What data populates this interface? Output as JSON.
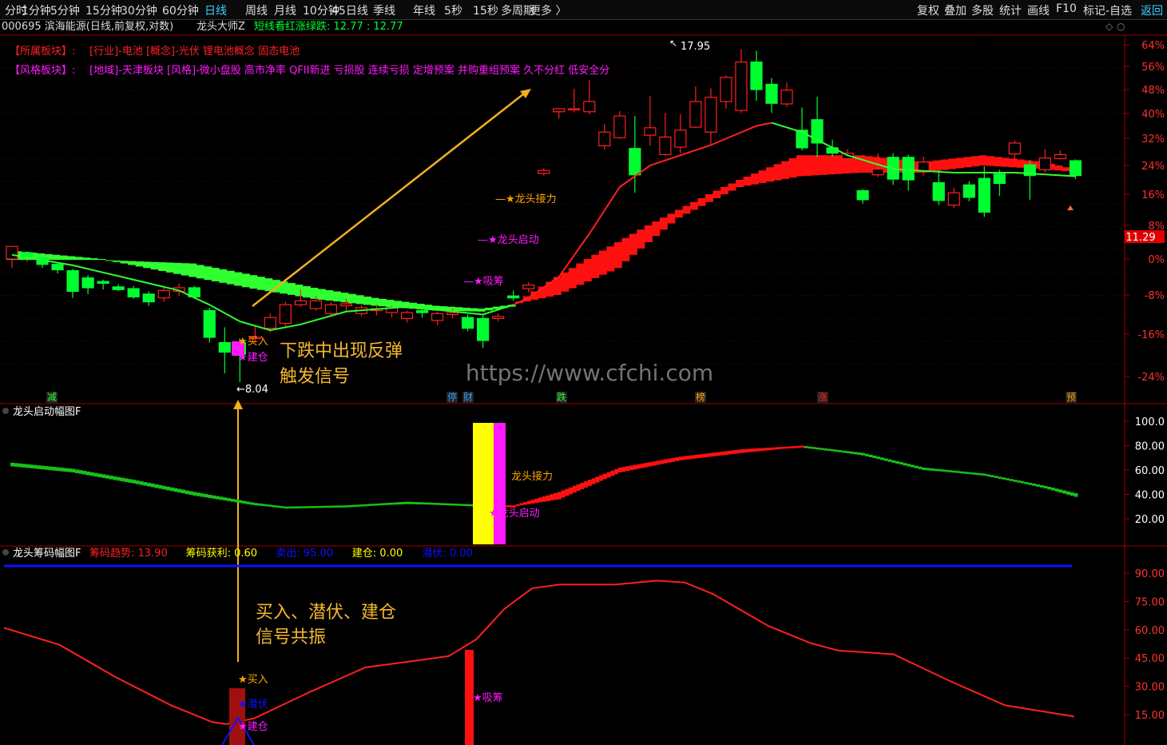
{
  "toolbar": {
    "left": [
      "分时",
      "1分钟",
      "5分钟",
      "15分钟",
      "30分钟",
      "60分钟",
      "日线",
      "周线",
      "月线",
      "10分钟",
      "45日线",
      "季线",
      "年线",
      "5秒",
      "15秒",
      "多周期",
      "更多 〉"
    ],
    "active": "日线",
    "right": [
      "复权",
      "叠加",
      "多股",
      "统计",
      "画线",
      "F10",
      "标记-自选",
      "返回"
    ]
  },
  "header": {
    "stock": "000695 滨海能源(日线,前复权,对数)",
    "indicator": "龙头大师Z",
    "indicator_note": "短线看红涨绿跌: 12.77 : 12.77"
  },
  "sector": {
    "row1": [
      "【所属板块】:",
      "[行业]-电池 [概念]-光伏 锂电池概念 固态电池"
    ],
    "row2": [
      "【风格板块】:",
      "[地域]-天津板块 [风格]-微小盘股 高市净率 QFII新进 亏损股 连续亏损 定增预案 并购重组预案 久不分红 低安全分"
    ]
  },
  "colors": {
    "up": "#ff2020",
    "down": "#00ff30",
    "blue": "#1010ff",
    "yellow": "#ffff00",
    "magenta": "#ff1aff",
    "orange": "#ffa500",
    "annot": "#e6a817",
    "price_tag": "#ff0000"
  },
  "chart_data": [
    {
      "type": "candlestick",
      "title": "龙头大师Z",
      "yaxis_ticks": [
        "64%",
        "56%",
        "48%",
        "40%",
        "32%",
        "24%",
        "16%",
        "8%",
        "0%",
        "-8%",
        "-16%",
        "-24%"
      ],
      "ylim": [
        -28,
        68
      ],
      "candles": [
        [
          2,
          0,
          3,
          -2,
          3
        ],
        [
          3,
          1.5,
          0.3,
          -0.5,
          1.8
        ],
        [
          4,
          0.3,
          -1.2,
          -2,
          0.6
        ],
        [
          5,
          -1.2,
          -2.4,
          -3.2,
          -0.8
        ],
        [
          6,
          -2.6,
          -7.2,
          -8.6,
          -2.2
        ],
        [
          7,
          -4.2,
          -6.4,
          -7.8,
          -3.6
        ],
        [
          8,
          -5,
          -5.4,
          -6.8,
          -4.6
        ],
        [
          9,
          -6.2,
          -6.8,
          -7.2,
          -5.6
        ],
        [
          10,
          -6.6,
          -8.4,
          -8.8,
          -6
        ],
        [
          11,
          -7.8,
          -9.4,
          -10.2,
          -7.2
        ],
        [
          12,
          -8.6,
          -7,
          -9.4,
          -6.4
        ],
        [
          13,
          -7.2,
          -6.4,
          -8.2,
          -5.4
        ],
        [
          14,
          -6.4,
          -8.4,
          -8.8,
          -6
        ],
        [
          15,
          -11.2,
          -16.6,
          -17.6,
          -10.6
        ],
        [
          16,
          -17.6,
          -19.4,
          -23.4,
          -14.6
        ],
        [
          17,
          -17.6,
          -19.8,
          -25,
          -16.8
        ],
        [
          18,
          -16.8,
          -16.6,
          -17.6,
          -14.4
        ],
        [
          19,
          -14.8,
          -12.6,
          -15.6,
          -11.8
        ],
        [
          20,
          -13.8,
          -10,
          -14.4,
          -9.4
        ],
        [
          21,
          -10,
          -9.2,
          -10.4,
          -6.8
        ],
        [
          22,
          -10.8,
          -9.2,
          -11.2,
          -8.2
        ],
        [
          23,
          -11.8,
          -10,
          -12.2,
          -9.4
        ],
        [
          24,
          -10.2,
          -9.8,
          -11.4,
          -8.8
        ],
        [
          25,
          -11.8,
          -10.6,
          -12.4,
          -10
        ],
        [
          26,
          -11.2,
          -10.8,
          -12.2,
          -10
        ],
        [
          27,
          -11.6,
          -10.6,
          -12.6,
          -10.2
        ],
        [
          28,
          -12.8,
          -11.6,
          -13.6,
          -11.2
        ],
        [
          29,
          -11.2,
          -11.6,
          -12.6,
          -10.4
        ],
        [
          30,
          -13.2,
          -11.8,
          -14.2,
          -11.4
        ],
        [
          31,
          -12,
          -11.6,
          -12.8,
          -10.8
        ],
        [
          32,
          -12.6,
          -14.8,
          -15.4,
          -12
        ],
        [
          33,
          -12.8,
          -17.2,
          -18.6,
          -12.2
        ],
        [
          34,
          -12.8,
          -12.4,
          -13.4,
          -11.8
        ],
        [
          35,
          -8.2,
          -8.6,
          -9.2,
          -7
        ],
        [
          36,
          -6.6,
          -5.8,
          -7.4,
          -5.2
        ],
        [
          37,
          21.8,
          22.6,
          23.2,
          21.2
        ],
        [
          38,
          40.6,
          41.6,
          41.8,
          38.4
        ],
        [
          39,
          41.4,
          41.6,
          48.2,
          40.4
        ],
        [
          40,
          40.6,
          44,
          51.2,
          39.8
        ],
        [
          41,
          29.8,
          34,
          36.6,
          28.6
        ],
        [
          42,
          32.2,
          39.2,
          40.8,
          31.8
        ],
        [
          43,
          29,
          21.4,
          39.2,
          16.4
        ],
        [
          44,
          33,
          35.4,
          45.8,
          29.8
        ],
        [
          45,
          27.2,
          32.4,
          40.2,
          26.8
        ],
        [
          46,
          29.4,
          34.6,
          39.8,
          27.6
        ],
        [
          47,
          35.6,
          44,
          49,
          35.4
        ],
        [
          48,
          34,
          45.4,
          48.4,
          30
        ],
        [
          49,
          44,
          52.2,
          52.8,
          41.6
        ],
        [
          50,
          41,
          57.6,
          62.4,
          40.2
        ],
        [
          51,
          57.6,
          48,
          61.8,
          44.2
        ],
        [
          52,
          49.8,
          43.4,
          52,
          40.2
        ],
        [
          53,
          43.2,
          47.8,
          50.4,
          42.2
        ],
        [
          54,
          34.6,
          29.2,
          42,
          28.4
        ],
        [
          55,
          38,
          30.6,
          45.6,
          26.4
        ],
        [
          56,
          29.2,
          27.6,
          31.6,
          26.6
        ],
        [
          57,
          26,
          27.6,
          28.8,
          25
        ],
        [
          58,
          17,
          14.6,
          17.4,
          13.6
        ],
        [
          59,
          21.4,
          23,
          27.6,
          20.8
        ],
        [
          60,
          26.4,
          20.2,
          27.6,
          18.6
        ],
        [
          61,
          26.4,
          20,
          27.2,
          17
        ],
        [
          62,
          22.2,
          25,
          26.6,
          21.2
        ],
        [
          63,
          19.2,
          14.4,
          22.6,
          13.2
        ],
        [
          64,
          13.2,
          16.4,
          17.8,
          12.4
        ],
        [
          65,
          18.6,
          15.2,
          19.6,
          14.2
        ],
        [
          66,
          20.4,
          11.4,
          23.8,
          10.2
        ],
        [
          67,
          21.6,
          19,
          22.8,
          15.6
        ],
        [
          68,
          27.4,
          30.6,
          31.4,
          24.2
        ],
        [
          69,
          24.2,
          21.2,
          25.4,
          14.6
        ],
        [
          70,
          22.8,
          26.2,
          28.8,
          22
        ],
        [
          71,
          26,
          27.2,
          28.4,
          25.8
        ],
        [
          72,
          25.4,
          21.2,
          25.8,
          20.2
        ]
      ],
      "ma_line_points": "short-term trend line",
      "band_note": "trend ribbon (green = downtrend, red = uptrend)",
      "labels": {
        "price_high": "17.95",
        "price_low": "8.04",
        "current_price": "11.29",
        "buy": "★买入",
        "build": "★建仓",
        "absorb": "★吸筹",
        "start": "★龙头启动",
        "relay": "★龙头接力"
      },
      "bottom_tags": [
        "减",
        "停",
        "财",
        "跌",
        "榜",
        "涨",
        "预"
      ],
      "annotation": [
        "下跌中出现反弹",
        "触发信号"
      ],
      "watermark": "https://www.cfchi.com"
    },
    {
      "type": "line",
      "title": "龙头启动幅图F",
      "yaxis_ticks": [
        "100.0",
        "80.00",
        "60.00",
        "40.00",
        "20.00"
      ],
      "ylim": [
        0,
        110
      ],
      "labels": {
        "relay": "龙头接力",
        "start": "★龙头启动"
      }
    },
    {
      "type": "line",
      "title": "龙头筹码幅图F",
      "legend": [
        {
          "name": "筹码趋势",
          "value": "13.90",
          "color": "#ff2020"
        },
        {
          "name": "筹码获利",
          "value": "0.60",
          "color": "#ffff00"
        },
        {
          "name": "卖出",
          "value": "95.00",
          "color": "#1010ff"
        },
        {
          "name": "建仓",
          "value": "0.00",
          "color": "#ffff00"
        },
        {
          "name": "潜伏",
          "value": "0.00",
          "color": "#1010ff"
        }
      ],
      "yaxis_ticks": [
        "90.00",
        "75.00",
        "60.00",
        "45.00",
        "30.00",
        "15.00"
      ],
      "ylim": [
        0,
        100
      ],
      "labels": {
        "buy": "★买入",
        "lurk": "★潜伏",
        "build": "★建仓",
        "absorb": "★吸筹"
      },
      "annotation": [
        "买入、潜伏、建仓",
        "信号共振"
      ]
    }
  ]
}
